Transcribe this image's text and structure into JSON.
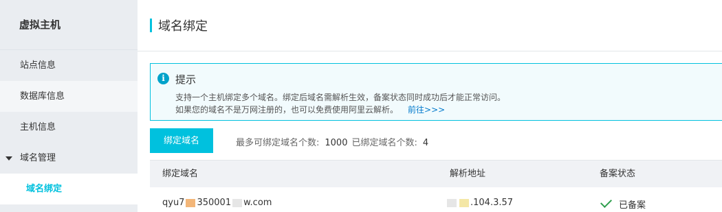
{
  "sidebar": {
    "title": "虚拟主机",
    "items": [
      {
        "label": "站点信息"
      },
      {
        "label": "数据库信息"
      },
      {
        "label": "主机信息"
      }
    ],
    "group": {
      "label": "域名管理"
    },
    "sub_items": [
      {
        "label": "域名绑定"
      }
    ]
  },
  "header": {
    "title": "域名绑定"
  },
  "tip": {
    "icon": "info-icon",
    "title": "提示",
    "line1": "支持一个主机绑定多个域名。绑定后域名需解析生效，备案状态同时成功后才能正常访问。",
    "line2": "如果您的域名不是万网注册的，也可以免费使用阿里云解析。",
    "link": "前往>>>"
  },
  "toolbar": {
    "bind_label": "绑定域名",
    "max_label": "最多可绑定域名个数:",
    "max_value": "1000",
    "bound_label": "已绑定域名个数:",
    "bound_value": "4"
  },
  "table": {
    "columns": [
      "绑定域名",
      "解析地址",
      "备案状态"
    ],
    "rows": [
      {
        "domain_a": "qyu7",
        "domain_b": "350001",
        "domain_c": "w.com",
        "address": ".104.3.57",
        "status": "已备案"
      }
    ]
  },
  "colors": {
    "accent": "#00c1de",
    "link": "#0079cc",
    "success": "#2e9e4d"
  }
}
